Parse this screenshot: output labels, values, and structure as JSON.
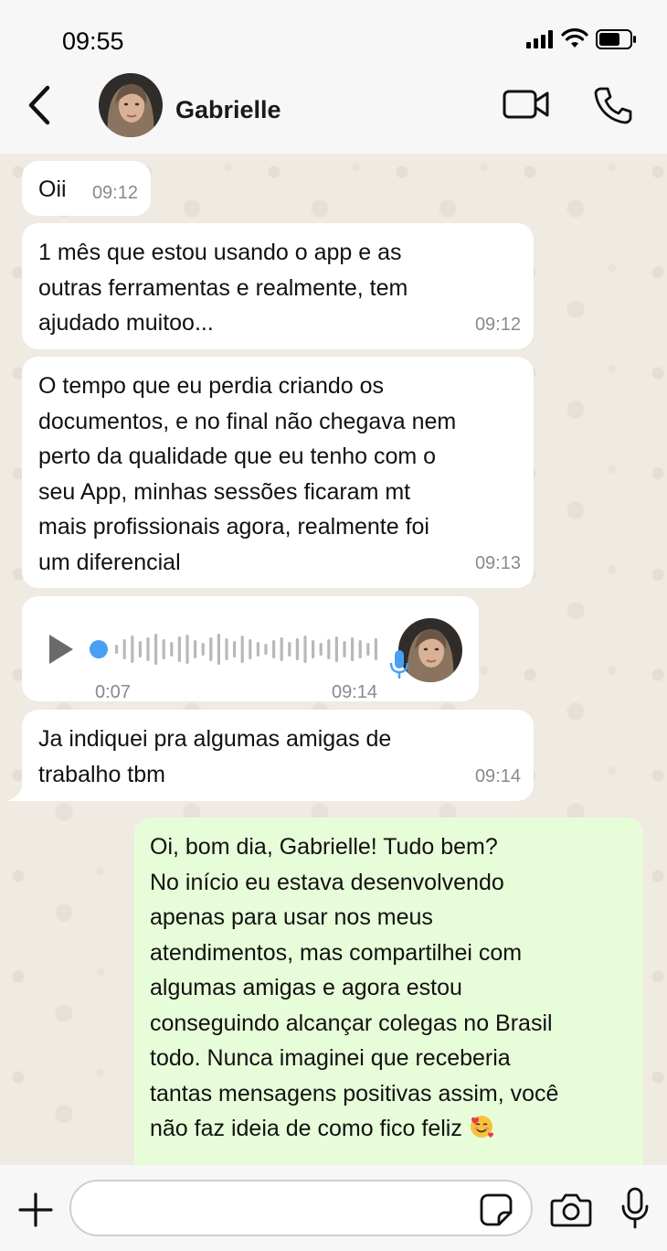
{
  "status_bar": {
    "time": "09:55"
  },
  "header": {
    "contact_name": "Gabrielle"
  },
  "messages": [
    {
      "direction": "in",
      "text": "Oii",
      "time": "09:12"
    },
    {
      "direction": "in",
      "text": "1 mês que estou usando o app e as\noutras ferramentas e realmente, tem\najudado muitoo...",
      "time": "09:12"
    },
    {
      "direction": "in",
      "text": "O tempo que eu perdia criando os\ndocumentos, e no final não chegava nem\nperto da qualidade que eu tenho com o\nseu App, minhas sessões ficaram mt\nmais profissionais agora, realmente foi\num diferencial",
      "time": "09:13"
    },
    {
      "direction": "in",
      "type": "voice",
      "duration": "0:07",
      "time": "09:14",
      "progress": 0
    },
    {
      "direction": "in",
      "text": "Ja indiquei pra algumas amigas de\ntrabalho tbm",
      "time": "09:14"
    },
    {
      "direction": "out",
      "text": "Oi, bom dia, Gabrielle! Tudo bem?\nNo início eu estava desenvolvendo\napenas para usar nos meus\natendimentos, mas compartilhei com\nalgumas amigas e agora estou\nconseguindo alcançar colegas no Brasil\ntodo. Nunca imaginei que receberia\ntantas mensagens positivas assim, você\nnão faz ideia de como fico feliz ",
      "emoji": "smiling-face-with-hearts"
    }
  ],
  "composer": {
    "value": "",
    "placeholder": ""
  },
  "icons": {
    "back": "chevron-left-icon",
    "video": "video-camera-icon",
    "call": "phone-icon",
    "add": "plus-icon",
    "sticker": "sticker-icon",
    "camera": "camera-icon",
    "mic": "microphone-icon"
  },
  "colors": {
    "incoming_bubble": "#ffffff",
    "outgoing_bubble": "#e7fdd9",
    "chat_background": "#efeae2",
    "voice_accent": "#4a9ff5"
  }
}
